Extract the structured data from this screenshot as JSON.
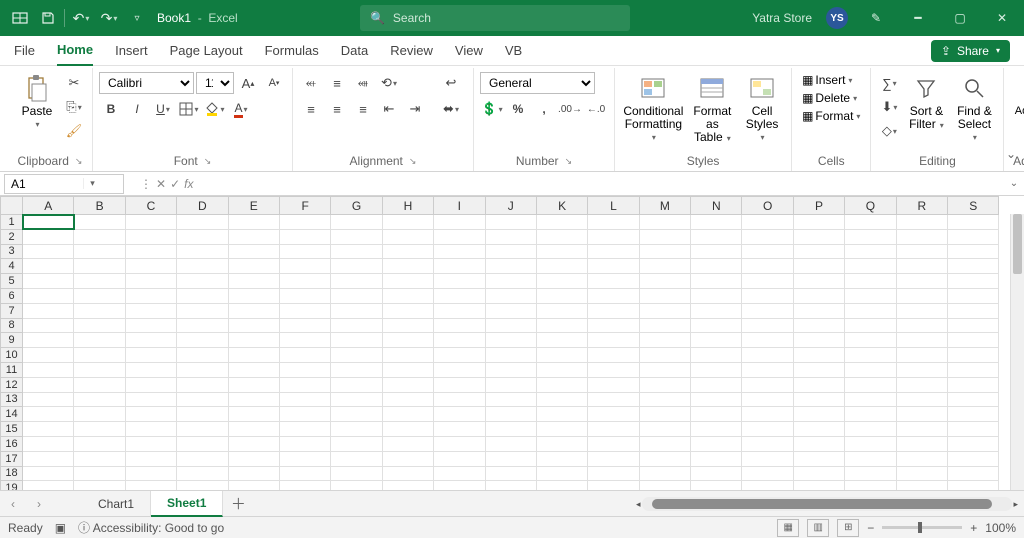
{
  "title": {
    "docname": "Book1",
    "appname": "Excel"
  },
  "search": {
    "placeholder": "Search"
  },
  "user": {
    "name": "Yatra Store",
    "initials": "YS"
  },
  "tabs": [
    "File",
    "Home",
    "Insert",
    "Page Layout",
    "Formulas",
    "Data",
    "Review",
    "View",
    "VB"
  ],
  "active_tab": "Home",
  "share_label": "Share",
  "ribbon": {
    "clipboard": {
      "paste": "Paste",
      "label": "Clipboard"
    },
    "font": {
      "name": "Calibri",
      "size": "11",
      "label": "Font"
    },
    "alignment": {
      "label": "Alignment"
    },
    "number": {
      "format": "General",
      "label": "Number"
    },
    "styles": {
      "cond": "Conditional Formatting",
      "table": "Format as Table",
      "cell": "Cell Styles",
      "label": "Styles"
    },
    "cells": {
      "insert": "Insert",
      "delete": "Delete",
      "format": "Format",
      "label": "Cells"
    },
    "editing": {
      "sort": "Sort & Filter",
      "find": "Find & Select",
      "label": "Editing"
    },
    "addins": {
      "btn": "Add-ins",
      "label": "Add-ins"
    }
  },
  "namebox": "A1",
  "columns": [
    "A",
    "B",
    "C",
    "D",
    "E",
    "F",
    "G",
    "H",
    "I",
    "J",
    "K",
    "L",
    "M",
    "N",
    "O",
    "P",
    "Q",
    "R",
    "S"
  ],
  "rows": 20,
  "sheet_tabs": [
    "Chart1",
    "Sheet1"
  ],
  "active_sheet": "Sheet1",
  "status": {
    "ready": "Ready",
    "access": "Accessibility: Good to go",
    "zoom": "100%"
  }
}
